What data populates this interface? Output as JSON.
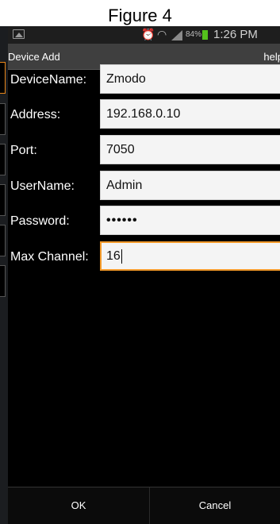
{
  "figure_title": "Figure 4",
  "status_bar": {
    "battery_percent": "84%",
    "time": "1:26 PM",
    "icons": [
      "gallery-icon",
      "alarm-icon",
      "wifi-icon",
      "signal-icon",
      "battery-icon"
    ],
    "battery_color": "#54c21c"
  },
  "titlebar": {
    "title": "Device Add",
    "help": "help"
  },
  "form": {
    "device_name": {
      "label": "DeviceName:",
      "value": "Zmodo"
    },
    "address": {
      "label": "Address:",
      "value": "192.168.0.10"
    },
    "port": {
      "label": "Port:",
      "value": "7050"
    },
    "username": {
      "label": "UserName:",
      "value": "Admin"
    },
    "password": {
      "label": "Password:",
      "value": "••••••"
    },
    "max_channel": {
      "label": "Max Channel:",
      "value": "16"
    }
  },
  "buttons": {
    "ok": "OK",
    "cancel": "Cancel"
  },
  "colors": {
    "focus_accent": "#f39a2a",
    "background": "#000000",
    "titlebar": "#3f3f3f"
  }
}
